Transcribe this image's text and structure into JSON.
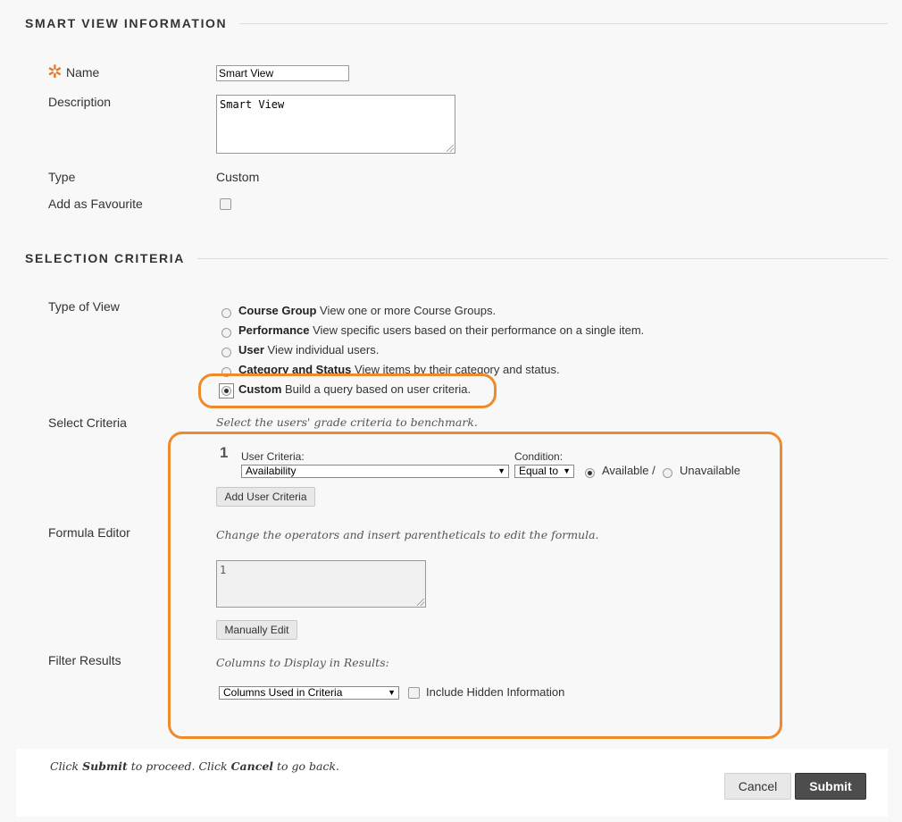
{
  "sections": {
    "info_title": "SMART VIEW INFORMATION",
    "criteria_title": "SELECTION CRITERIA"
  },
  "fields": {
    "name_label": "Name",
    "name_value": "Smart View",
    "description_label": "Description",
    "description_value": "Smart View",
    "type_label": "Type",
    "type_value": "Custom",
    "favourite_label": "Add as Favourite"
  },
  "type_of_view": {
    "label": "Type of View",
    "options": [
      {
        "title": "Course Group",
        "desc": "View one or more Course Groups.",
        "checked": false
      },
      {
        "title": "Performance",
        "desc": "View specific users based on their performance on a single item.",
        "checked": false
      },
      {
        "title": "User",
        "desc": "View individual users.",
        "checked": false
      },
      {
        "title": "Category and Status",
        "desc": "View items by their category and status.",
        "checked": false
      },
      {
        "title": "Custom",
        "desc": "Build a query based on user criteria.",
        "checked": true
      }
    ]
  },
  "select_criteria": {
    "label": "Select Criteria",
    "hint": "Select the users' grade criteria to benchmark.",
    "row_number": "1",
    "user_criteria_label": "User Criteria:",
    "user_criteria_value": "Availability",
    "condition_label": "Condition:",
    "condition_value": "Equal to",
    "available_label": "Available /",
    "unavailable_label": "Unavailable",
    "add_button": "Add User Criteria"
  },
  "formula": {
    "label": "Formula Editor",
    "hint": "Change the operators and insert parentheticals to edit the formula.",
    "value": "1",
    "edit_button": "Manually Edit"
  },
  "filter": {
    "label": "Filter Results",
    "hint": "Columns to Display in Results:",
    "columns_value": "Columns Used in Criteria",
    "hidden_label": "Include Hidden Information"
  },
  "footer": {
    "prefix": "Click ",
    "submit_word": "Submit",
    "middle": " to proceed. Click ",
    "cancel_word": "Cancel",
    "suffix": " to go back.",
    "cancel_button": "Cancel",
    "submit_button": "Submit"
  },
  "colors": {
    "highlight": "#ee8a2b",
    "required": "#e87722",
    "submit_bg": "#4d4d4d"
  }
}
